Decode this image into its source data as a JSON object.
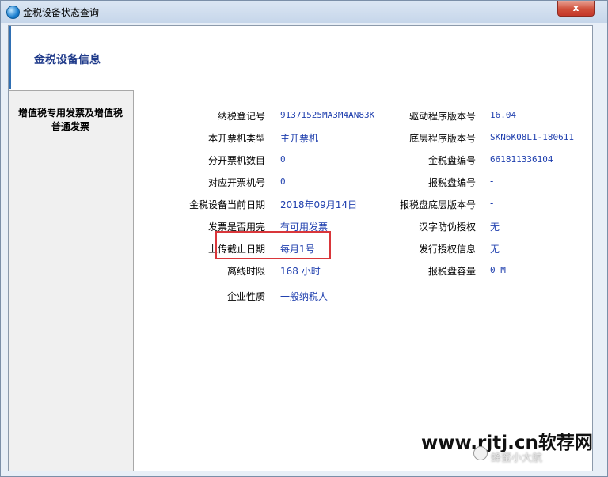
{
  "window": {
    "title": "金税设备状态查询",
    "close_label": "x"
  },
  "header": {
    "title": "金税设备信息"
  },
  "sidebar": {
    "items": [
      {
        "label": "增值税专用发票及增值税普通发票"
      }
    ]
  },
  "info": {
    "left": [
      {
        "label": "纳税登记号",
        "value": "91371525MA3M4AN83K"
      },
      {
        "label": "本开票机类型",
        "value": "主开票机"
      },
      {
        "label": "分开票机数目",
        "value": "0"
      },
      {
        "label": "对应开票机号",
        "value": "0"
      },
      {
        "label": "金税设备当前日期",
        "value": "2018年09月14日"
      },
      {
        "label": "发票是否用完",
        "value": "有可用发票"
      },
      {
        "label": "上传截止日期",
        "value": "每月1号"
      },
      {
        "label": "离线时限",
        "value": "168 小时"
      },
      {
        "label": "企业性质",
        "value": "一般纳税人"
      }
    ],
    "right": [
      {
        "label": "驱动程序版本号",
        "value": "16.04"
      },
      {
        "label": "底层程序版本号",
        "value": "SKN6K08L1-180611"
      },
      {
        "label": "金税盘编号",
        "value": "661811336104"
      },
      {
        "label": "报税盘编号",
        "value": "-"
      },
      {
        "label": "报税盘底层版本号",
        "value": "-"
      },
      {
        "label": "汉字防伪授权",
        "value": "无"
      },
      {
        "label": "发行授权信息",
        "value": "无"
      },
      {
        "label": "报税盘容量",
        "value": "0 M"
      }
    ]
  },
  "watermark": {
    "text": "www.rjtj.cn软荐网",
    "sub": "蜂蜜小大航"
  },
  "colors": {
    "value_text": "#1f3fae",
    "title_text": "#1f3a8a",
    "highlight": "#d9363a"
  }
}
